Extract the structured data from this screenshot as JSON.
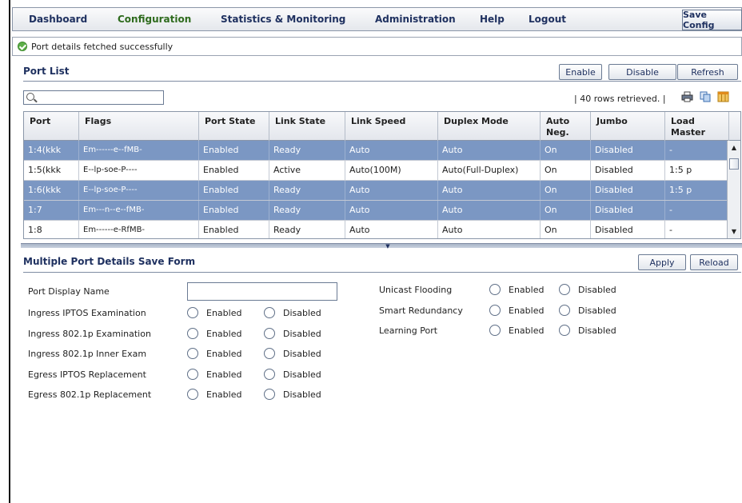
{
  "nav": {
    "items": [
      "Dashboard",
      "Configuration",
      "Statistics & Monitoring",
      "Administration",
      "Help",
      "Logout"
    ],
    "active": "Configuration",
    "save_config": "Save Config"
  },
  "status": {
    "message": "Port details fetched successfully"
  },
  "port_list": {
    "title": "Port List",
    "buttons": {
      "enable": "Enable",
      "disable": "Disable",
      "refresh": "Refresh"
    },
    "search_value": "",
    "rows_retrieved": "| 40 rows retrieved. |",
    "columns": [
      "Port",
      "Flags",
      "Port State",
      "Link State",
      "Link Speed",
      "Duplex Mode",
      "Auto Neg.",
      "Jumbo",
      "Load Master"
    ],
    "rows": [
      {
        "selected": true,
        "cells": [
          "1:4(kkk",
          "Em------e--fMB-",
          "Enabled",
          "Ready",
          "Auto",
          "Auto",
          "On",
          "Disabled",
          "-"
        ]
      },
      {
        "selected": false,
        "cells": [
          "1:5(kkk",
          "E--lp-soe-P----",
          "Enabled",
          "Active",
          "Auto(100M)",
          "Auto(Full-Duplex)",
          "On",
          "Disabled",
          "1:5 p"
        ]
      },
      {
        "selected": true,
        "cells": [
          "1:6(kkk",
          "E--lp-soe-P----",
          "Enabled",
          "Ready",
          "Auto",
          "Auto",
          "On",
          "Disabled",
          "1:5 p"
        ]
      },
      {
        "selected": true,
        "cells": [
          "1:7",
          "Em---n--e--fMB-",
          "Enabled",
          "Ready",
          "Auto",
          "Auto",
          "On",
          "Disabled",
          "-"
        ]
      },
      {
        "selected": false,
        "cells": [
          "1:8",
          "Em------e-RfMB-",
          "Enabled",
          "Ready",
          "Auto",
          "Auto",
          "On",
          "Disabled",
          "-"
        ]
      }
    ]
  },
  "form": {
    "title": "Multiple Port Details Save Form",
    "buttons": {
      "apply": "Apply",
      "reload": "Reload"
    },
    "display_name_label": "Port Display Name",
    "display_name_value": "",
    "enabled_label": "Enabled",
    "disabled_label": "Disabled",
    "left_fields": [
      "Ingress IPTOS Examination",
      "Ingress 802.1p Examination",
      "Ingress 802.1p Inner Exam",
      "Egress IPTOS Replacement",
      "Egress 802.1p Replacement"
    ],
    "right_fields": [
      "Unicast Flooding",
      "Smart Redundancy",
      "Learning Port"
    ]
  }
}
